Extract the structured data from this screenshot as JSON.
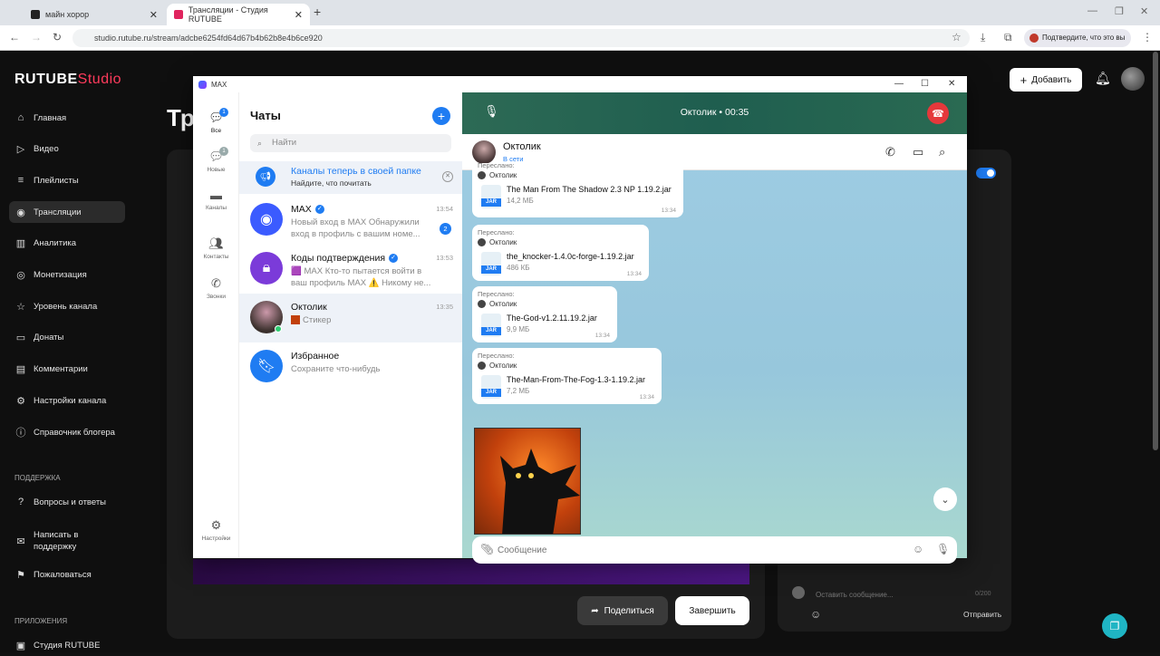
{
  "browser": {
    "tabs": [
      {
        "title": "майн хорор",
        "active": false
      },
      {
        "title": "Трансляции - Студия RUTUBE",
        "active": true
      }
    ],
    "url": "studio.rutube.ru/stream/adcbe6254fd64d67b4b62b8e4b6ce920",
    "confirm_text": "Подтвердите, что это вы"
  },
  "studio": {
    "logo_main": "RUTUBE",
    "logo_sub": "Studio",
    "nav": [
      {
        "label": "Главная",
        "icon": "home-icon"
      },
      {
        "label": "Видео",
        "icon": "video-icon"
      },
      {
        "label": "Плейлисты",
        "icon": "playlist-icon"
      },
      {
        "label": "Трансляции",
        "icon": "broadcast-icon",
        "active": true
      },
      {
        "label": "Аналитика",
        "icon": "analytics-icon"
      },
      {
        "label": "Монетизация",
        "icon": "money-icon"
      },
      {
        "label": "Уровень канала",
        "icon": "star-icon"
      },
      {
        "label": "Донаты",
        "icon": "donate-icon"
      },
      {
        "label": "Комментарии",
        "icon": "comments-icon"
      },
      {
        "label": "Настройки канала",
        "icon": "gear-icon"
      },
      {
        "label": "Справочник блогера",
        "icon": "info-icon"
      }
    ],
    "support_title": "ПОДДЕРЖКА",
    "support": [
      {
        "label": "Вопросы и ответы"
      },
      {
        "label": "Написать в поддержку"
      },
      {
        "label": "Пожаловаться"
      }
    ],
    "apps_title": "ПРИЛОЖЕНИЯ",
    "apps": [
      {
        "label": "Студия RUTUBE"
      }
    ],
    "add_button": "Добавить",
    "heading_partial": "Тр",
    "share_button": "Поделиться",
    "end_button": "Завершить",
    "leave_message": "Оставить сообщение...",
    "message_counter": "0/200",
    "send_button": "Отправить"
  },
  "max": {
    "window_title": "MAX",
    "rail": [
      {
        "label": "Все",
        "badge": "1",
        "active": true
      },
      {
        "label": "Новые",
        "badge": "1"
      },
      {
        "label": "Каналы"
      },
      {
        "label": "Контакты"
      },
      {
        "label": "Звонки"
      }
    ],
    "settings_label": "Настройки",
    "chats_title": "Чаты",
    "search_placeholder": "Найти",
    "promo": {
      "title": "Каналы теперь в своей папке",
      "subtitle": "Найдите, что почитать"
    },
    "chats": [
      {
        "name": "MAX",
        "verified": true,
        "time": "13:54",
        "preview": "Новый вход в MAX Обнаружили вход в профиль с вашим номе...",
        "badge": "2",
        "avatar_color": "#3b5bff"
      },
      {
        "name": "Коды подтверждения",
        "verified": true,
        "time": "13:53",
        "preview": "🟪 MAX Кто-то пытается войти в ваш профиль MAX ⚠️ Никому не...",
        "avatar_color": "#7b3bd9"
      },
      {
        "name": "Октолик",
        "time": "13:35",
        "preview": "Стикер",
        "avatar_color": "#5a4a44"
      },
      {
        "name": "Избранное",
        "preview": "Сохраните что-нибудь",
        "avatar_color": "#1f7cf2"
      }
    ],
    "call": {
      "name": "Октолик",
      "separator": "•",
      "duration": "00:35"
    },
    "contact": {
      "name": "Октолик",
      "status": "В сети"
    },
    "forwarded_label": "Переслано:",
    "messages": [
      {
        "from": "Октолик",
        "file": "The Man From The Shadow 2.3 NP 1.19.2.jar",
        "size": "14,2 МБ",
        "time": "13:34",
        "ext": "JAR"
      },
      {
        "from": "Октолик",
        "file": "the_knocker-1.4.0c-forge-1.19.2.jar",
        "size": "486 КБ",
        "time": "13:34",
        "ext": "JAR"
      },
      {
        "from": "Октолик",
        "file": "The-God-v1.2.11.19.2.jar",
        "size": "9,9 МБ",
        "time": "13:34",
        "ext": "JAR"
      },
      {
        "from": "Октолик",
        "file": "The-Man-From-The-Fog-1.3-1.19.2.jar",
        "size": "7,2 МБ",
        "time": "13:34",
        "ext": "JAR"
      }
    ],
    "composer_placeholder": "Сообщение"
  }
}
